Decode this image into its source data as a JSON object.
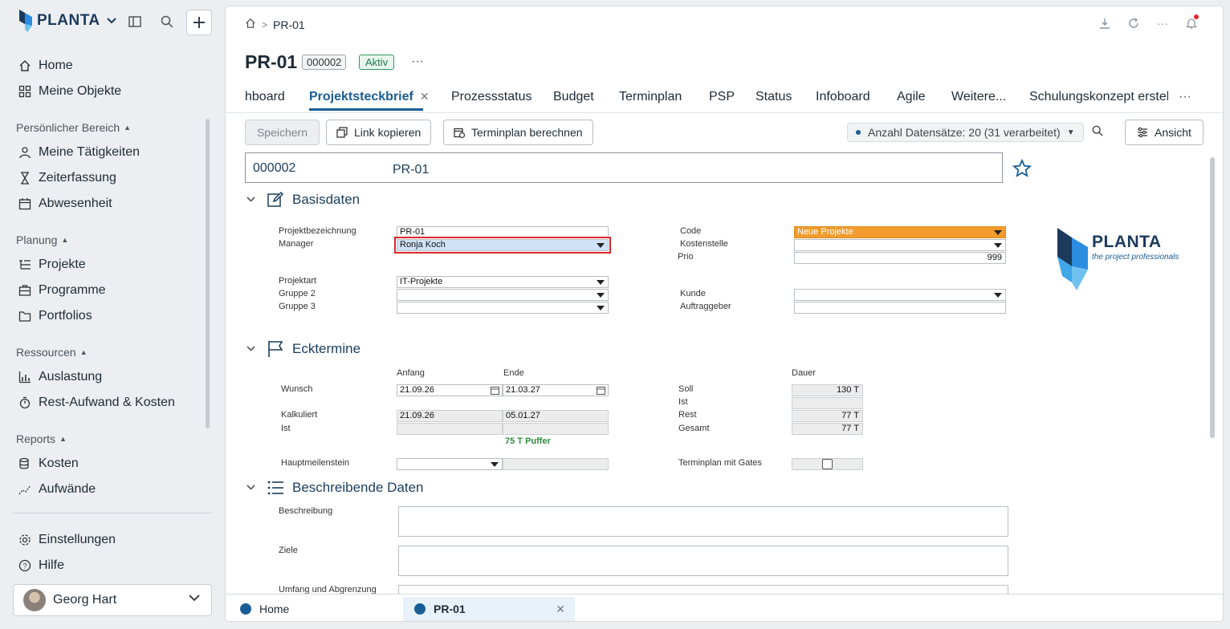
{
  "app": {
    "brand": "PLANTA"
  },
  "nav": {
    "home": "Home",
    "my_objects": "Meine Objekte",
    "personal_section": "Persönlicher Bereich",
    "my_activities": "Meine Tätigkeiten",
    "time_tracking": "Zeiterfassung",
    "absence": "Abwesenheit",
    "planning_section": "Planung",
    "projects": "Projekte",
    "programs": "Programme",
    "portfolios": "Portfolios",
    "resources_section": "Ressourcen",
    "utilization": "Auslastung",
    "rest_effort": "Rest-Aufwand & Kosten",
    "reports_section": "Reports",
    "costs": "Kosten",
    "efforts": "Aufwände",
    "settings": "Einstellungen",
    "help": "Hilfe",
    "user": "Georg Hart"
  },
  "breadcrumb": {
    "current": "PR-01"
  },
  "header": {
    "title": "PR-01",
    "id_badge": "000002",
    "status_badge": "Aktiv"
  },
  "tabs": [
    {
      "label": "hboard"
    },
    {
      "label": "Projektsteckbrief"
    },
    {
      "label": "Prozessstatus"
    },
    {
      "label": "Budget"
    },
    {
      "label": "Terminplan"
    },
    {
      "label": "PSP"
    },
    {
      "label": "Status"
    },
    {
      "label": "Infoboard"
    },
    {
      "label": "Agile"
    },
    {
      "label": "Weitere..."
    },
    {
      "label": "Schulungskonzept erstellen"
    }
  ],
  "toolbar": {
    "save": "Speichern",
    "copy_link": "Link kopieren",
    "calc_schedule": "Terminplan berechnen",
    "datasets": "Anzahl Datensätze: 20 (31 verarbeitet)",
    "view": "Ansicht"
  },
  "record": {
    "id": "000002",
    "name": "PR-01"
  },
  "basis": {
    "heading": "Basisdaten",
    "projektbezeichnung_label": "Projektbezeichnung",
    "projektbezeichnung": "PR-01",
    "manager_label": "Manager",
    "manager": "Ronja Koch",
    "projektart_label": "Projektart",
    "projektart": "IT-Projekte",
    "gruppe2_label": "Gruppe 2",
    "gruppe3_label": "Gruppe 3",
    "code_label": "Code",
    "code": "Neue Projekte",
    "kostenstelle_label": "Kostenstelle",
    "prio_label": "Prio",
    "prio": "999",
    "kunde_label": "Kunde",
    "auftraggeber_label": "Auftraggeber"
  },
  "logo": {
    "brand": "PLANTA",
    "tagline": "the project professionals"
  },
  "ecktermine": {
    "heading": "Ecktermine",
    "anfang_label": "Anfang",
    "ende_label": "Ende",
    "dauer_label": "Dauer",
    "wunsch_label": "Wunsch",
    "wunsch_anfang": "21.09.26",
    "wunsch_ende": "21.03.27",
    "kalkuliert_label": "Kalkuliert",
    "kalk_anfang": "21.09.26",
    "kalk_ende": "05.01.27",
    "ist_label": "Ist",
    "puffer": "75 T Puffer",
    "soll_label": "Soll",
    "soll": "130 T",
    "ist2_label": "Ist",
    "rest_label": "Rest",
    "rest": "77 T",
    "gesamt_label": "Gesamt",
    "gesamt": "77 T",
    "hauptmeilenstein_label": "Hauptmeilenstein",
    "gates_label": "Terminplan mit Gates"
  },
  "beschreibend": {
    "heading": "Beschreibende Daten",
    "beschreibung_label": "Beschreibung",
    "ziele_label": "Ziele",
    "umfang_label": "Umfang und Abgrenzung"
  },
  "bottom_tabs": [
    {
      "label": "Home"
    },
    {
      "label": "PR-01"
    }
  ],
  "colors": {
    "accent": "#1a5d96",
    "orange": "#f29b2e",
    "status_green": "#1f7a4a",
    "highlight": "#e0262c"
  }
}
